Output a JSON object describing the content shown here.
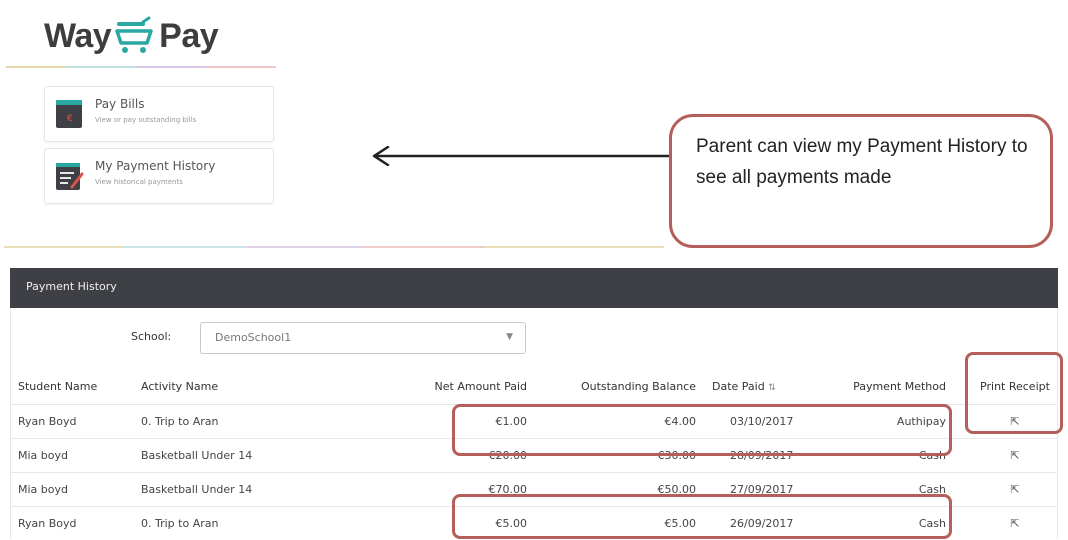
{
  "brand": {
    "left": "Way",
    "right": "Pay"
  },
  "menu": [
    {
      "title": "Pay Bills",
      "subtitle": "View or pay outstanding bills",
      "icon": "wallet-icon"
    },
    {
      "title": "My Payment History",
      "subtitle": "View historical payments",
      "icon": "history-list-icon"
    }
  ],
  "callout": {
    "text": "Parent can view my Payment History to see all payments made"
  },
  "payment_history": {
    "header": "Payment History",
    "school_label": "School:",
    "school_value": "DemoSchool1",
    "columns": [
      "Student Name",
      "Activity Name",
      "Net Amount Paid",
      "Outstanding Balance",
      "Date Paid",
      "Payment Method",
      "Print Receipt"
    ],
    "rows": [
      {
        "student": "Ryan Boyd",
        "activity": "0. Trip to Aran",
        "net": "€1.00",
        "outstanding": "€4.00",
        "date": "03/10/2017",
        "method": "Authipay"
      },
      {
        "student": "Mia boyd",
        "activity": "Basketball Under 14",
        "net": "€20.00",
        "outstanding": "€30.00",
        "date": "28/09/2017",
        "method": "Cash"
      },
      {
        "student": "Mia boyd",
        "activity": "Basketball Under 14",
        "net": "€70.00",
        "outstanding": "€50.00",
        "date": "27/09/2017",
        "method": "Cash"
      },
      {
        "student": "Ryan Boyd",
        "activity": "0. Trip to Aran",
        "net": "€5.00",
        "outstanding": "€5.00",
        "date": "26/09/2017",
        "method": "Cash"
      }
    ]
  },
  "colors": {
    "header_bg": "#3f4045",
    "annotation": "#b45f5a",
    "brand_teal": "#2aa7a1"
  }
}
